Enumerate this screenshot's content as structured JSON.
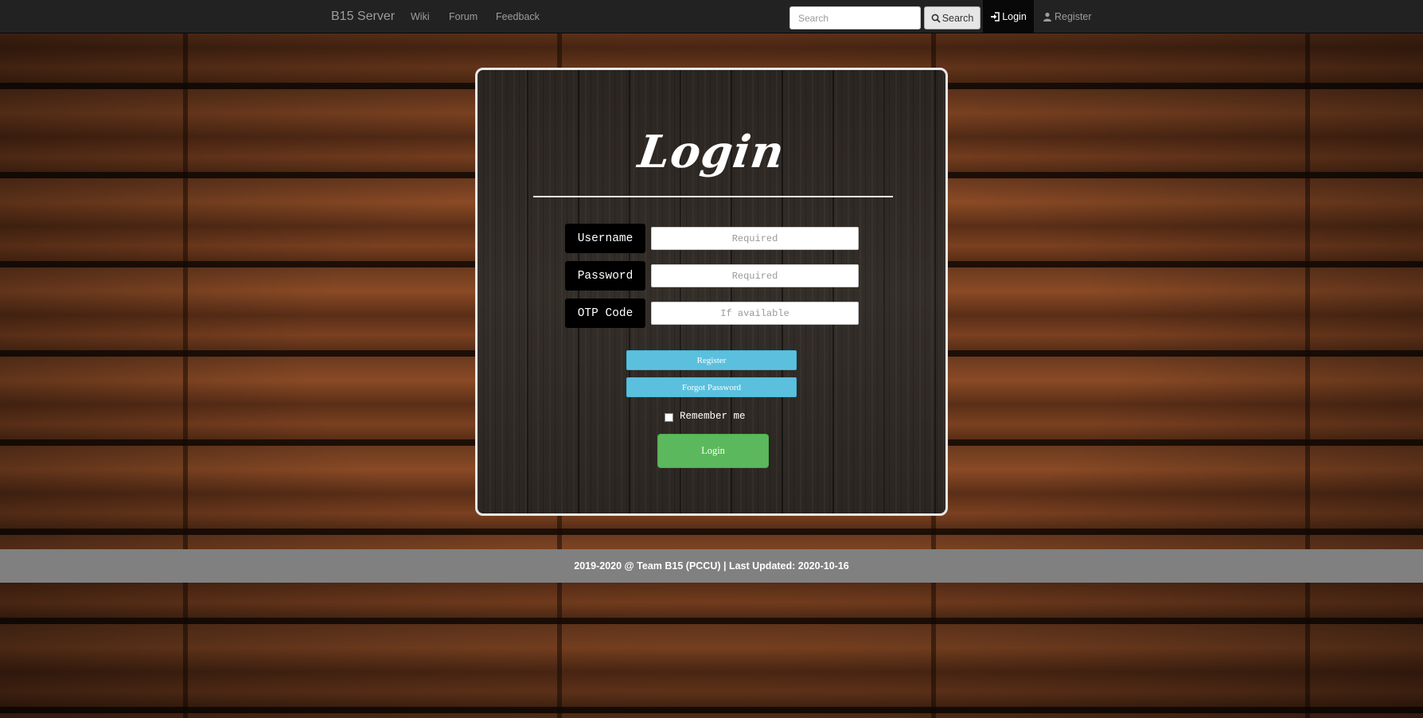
{
  "navbar": {
    "brand": "B15 Server",
    "links": [
      "Wiki",
      "Forum",
      "Feedback"
    ],
    "search_placeholder": "Search",
    "search_button": "Search",
    "login_label": "Login",
    "register_label": "Register",
    "icons": {
      "search": "search-icon",
      "login": "log-in-icon",
      "register": "user-icon"
    }
  },
  "login_form": {
    "title": "Login",
    "fields": [
      {
        "label": "Username",
        "placeholder": "Required"
      },
      {
        "label": "Password",
        "placeholder": "Required"
      },
      {
        "label": "OTP Code",
        "placeholder": "If available"
      }
    ],
    "register_button": "Register",
    "forgot_button": "Forgot Password",
    "remember_label": "Remember me",
    "submit_button": "Login"
  },
  "footer": {
    "text": "2019-2020 @ Team B15 (PCCU) | Last Updated: 2020-10-16"
  },
  "colors": {
    "navbar_bg": "#222222",
    "info_button": "#5bc0de",
    "success_button": "#5cb85c",
    "footer_bg": "#808080"
  }
}
